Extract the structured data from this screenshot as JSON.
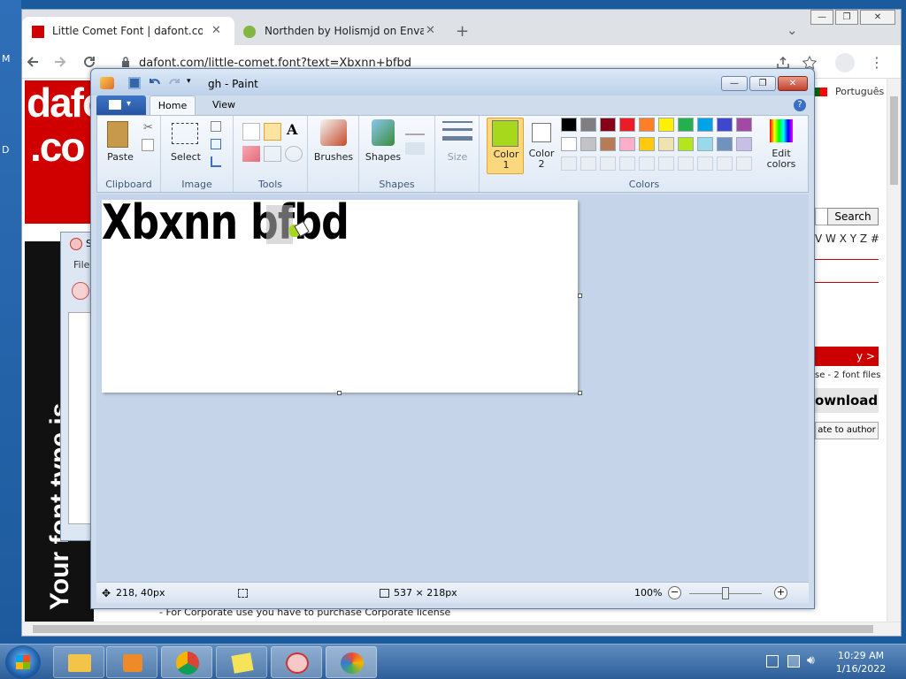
{
  "desktop": {
    "labels": [
      "M",
      "D"
    ]
  },
  "browser": {
    "tabs": [
      {
        "title": "Little Comet Font | dafont.com",
        "close": "✕"
      },
      {
        "title": "Northden by Holismjd on Envato",
        "close": "✕"
      }
    ],
    "new_tab": "+",
    "tab_list": "⌄",
    "window_controls": [
      "—",
      "❐",
      "✕"
    ],
    "url": "dafont.com/little-comet.font?text=Xbxnn+bfbd",
    "url_domain": "dafont.com",
    "url_path": "/little-comet.font?text=Xbxnn+bfbd"
  },
  "site": {
    "logo_lines": [
      "dafo",
      ".co"
    ],
    "lang": "Português",
    "search_button": "Search",
    "alphabet": "V W X Y Z #",
    "category": "y > Cartoon",
    "license": "se - 2 font files",
    "download": "ownload",
    "donate": "ate to author",
    "footer_text": "- For Corporate use you have to purchase Corporate license",
    "banner_text": "Your font type is"
  },
  "snip": {
    "title": "S",
    "menu": "File"
  },
  "paint": {
    "title": "gh - Paint",
    "tabs": {
      "home": "Home",
      "view": "View"
    },
    "groups": {
      "clipboard": "Clipboard",
      "image": "Image",
      "tools": "Tools",
      "shapes": "Shapes",
      "colors": "Colors"
    },
    "buttons": {
      "paste": "Paste",
      "select": "Select",
      "brushes": "Brushes",
      "shapes": "Shapes",
      "size": "Size",
      "color1": [
        "Color",
        "1"
      ],
      "color2": [
        "Color",
        "2"
      ],
      "edit_colors": [
        "Edit",
        "colors"
      ]
    },
    "color1_value": "#a8d81c",
    "color2_value": "#ffffff",
    "palette_row1": [
      "#000000",
      "#7f7f7f",
      "#880015",
      "#ed1c24",
      "#ff7f27",
      "#fff200",
      "#22b14c",
      "#00a2e8",
      "#3f48cc",
      "#a349a4"
    ],
    "palette_row2": [
      "#ffffff",
      "#c3c3c3",
      "#b97a57",
      "#ffaec9",
      "#ffc90e",
      "#efe4b0",
      "#b5e61d",
      "#99d9ea",
      "#7092be",
      "#c8bfe7"
    ],
    "canvas_text": "Xbxnn bfbd",
    "status": {
      "cursor": "218, 40px",
      "size": "537 × 218px",
      "zoom": "100%"
    }
  },
  "taskbar": {
    "time": "10:29 AM",
    "date": "1/16/2022"
  }
}
